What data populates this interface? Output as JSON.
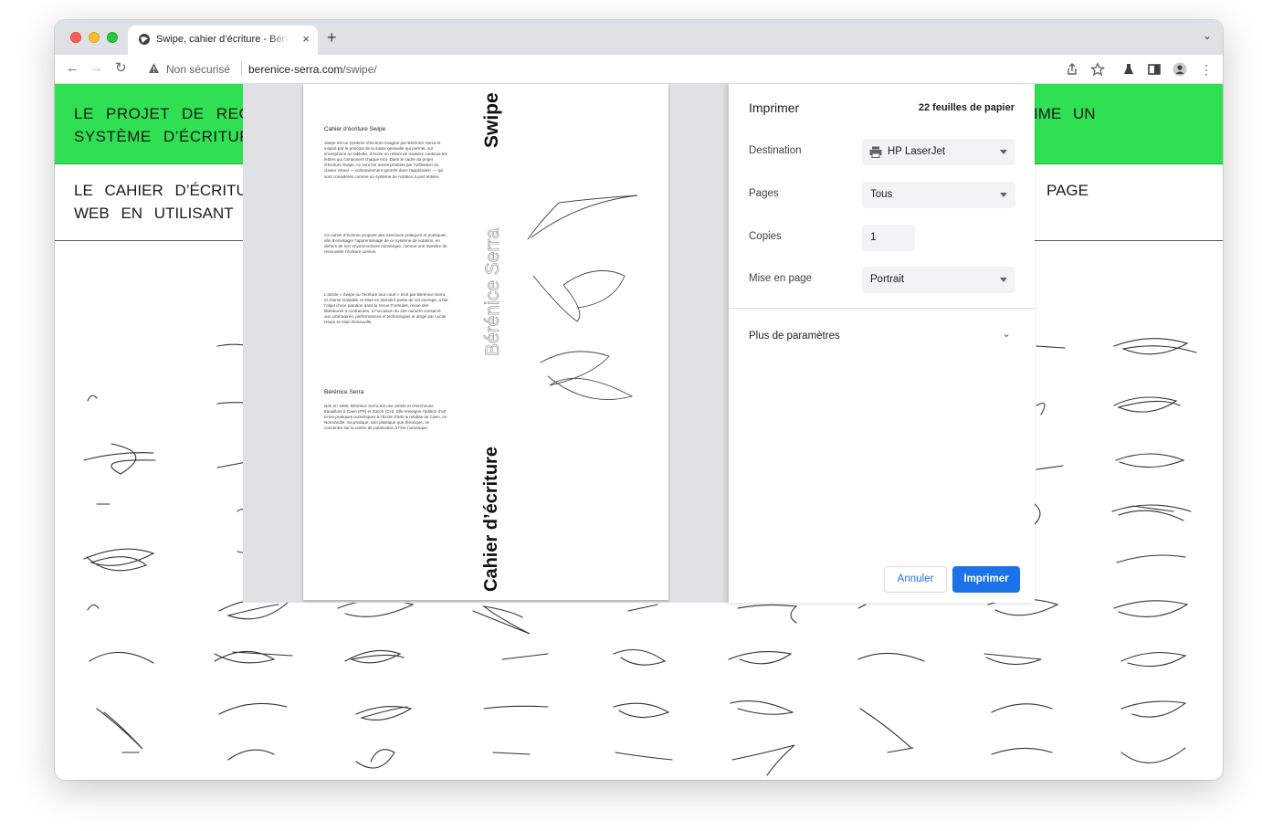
{
  "browser": {
    "tab_title": "Swipe, cahier d’écriture - Bérénice Serra",
    "tab_close": "×",
    "new_tab": "+",
    "url_security": "Non sécurisé",
    "url_domain": "berenice-serra.com",
    "url_path": "/swipe/"
  },
  "page": {
    "hero_line1": "LE PROJET DE RECH",
    "hero_line2": "SYSTÈME D’ÉCRITURE",
    "hero_right": "IME UN",
    "sub_line1": "LE CAHIER D’ÉCRITUF",
    "sub_line2": "WEB EN UTILISANT",
    "sub_right": "PAGE"
  },
  "preview": {
    "heading1": "Cahier d’écriture Swipe",
    "para1": "Swipe est un système d’écriture imaginé par Bérénice Serra et inspiré par le principe de la saisie gestuelle qui permet, sur smartphone ou tablette, d’écrire en reliant de manière continue les lettres qui composent chaque mot. Dans le cadre du projet d’écriture Swipe, ce sont les tracés produits par l’utilisation du clavier virtuel — volontairement ignorés dans l’application — qui sont considérés comme un système de notation à part entière.",
    "para2": "Ce cahier d’écriture propose des exercices pratiques et poétiques afin d’envisager l’apprentissage de ce système de notation, en dehors de son environnement numérique, comme une manière de renouveler l’écriture cursive.",
    "para3": "L’article « Swipe ou l’écriture tout court » écrit par Bérénice Serra et Gianni Gastaldi, et situé en dernière partie de cet ouvrage, a fait l’objet d’une parution dans la revue Formules, revue des littératures à contraintes, à l’occasion du 22e numéro consacré aux Littératures, performances et technologies et dirigé par Lucile Haute et Alain Deneuville.",
    "heading2": "Bérénice Serra",
    "para4": "Née en 1990, Bérénice Serra est une artiste et chercheuse travaillant à Caen (FR) et Zürich (CH). Elle enseigne l’édition d’art et les pratiques numériques à l’École d’arts & médias de Caen, en Normandie. Sa pratique, tant plastique que théorique, se concentre sur la notion de publication à l’ère numérique.",
    "rot_swipe": "Swipe",
    "rot_name": "Bérénice Serra",
    "rot_cahier": "Cahier d’écriture"
  },
  "dialog": {
    "title": "Imprimer",
    "sheets": "22 feuilles de papier",
    "destination_label": "Destination",
    "destination_value": "HP LaserJet",
    "pages_label": "Pages",
    "pages_value": "Tous",
    "copies_label": "Copies",
    "copies_value": "1",
    "layout_label": "Mise en page",
    "layout_value": "Portrait",
    "more_settings": "Plus de paramètres",
    "cancel": "Annuler",
    "print": "Imprimer"
  }
}
